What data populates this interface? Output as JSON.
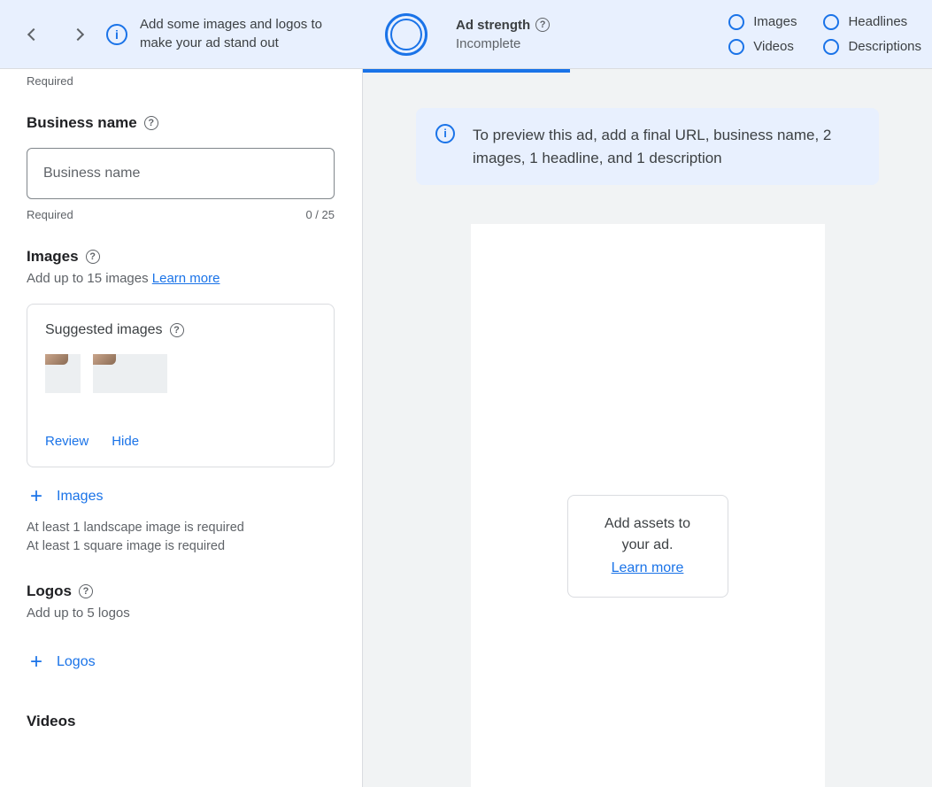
{
  "topbar": {
    "tip": "Add some images and logos to make your ad stand out",
    "strength_label": "Ad strength",
    "strength_value": "Incomplete",
    "check_items": [
      "Images",
      "Headlines",
      "Videos",
      "Descriptions"
    ]
  },
  "form": {
    "required_label": "Required",
    "business_name": {
      "title": "Business name",
      "placeholder": "Business name",
      "required": "Required",
      "counter": "0 / 25"
    },
    "images": {
      "title": "Images",
      "subtext": "Add up to 15 images ",
      "learn_more": "Learn more",
      "suggested_title": "Suggested images",
      "review": "Review",
      "hide": "Hide",
      "add_label": "Images",
      "validation_landscape": "At least 1 landscape image is required",
      "validation_square": "At least 1 square image is required"
    },
    "logos": {
      "title": "Logos",
      "subtext": "Add up to 5 logos",
      "add_label": "Logos"
    },
    "videos": {
      "title": "Videos"
    }
  },
  "preview": {
    "banner": "To preview this ad, add a final URL, business name, 2 images, 1 headline, and 1 description",
    "prompt_line": "Add assets to your ad.",
    "learn_more": "Learn more"
  }
}
